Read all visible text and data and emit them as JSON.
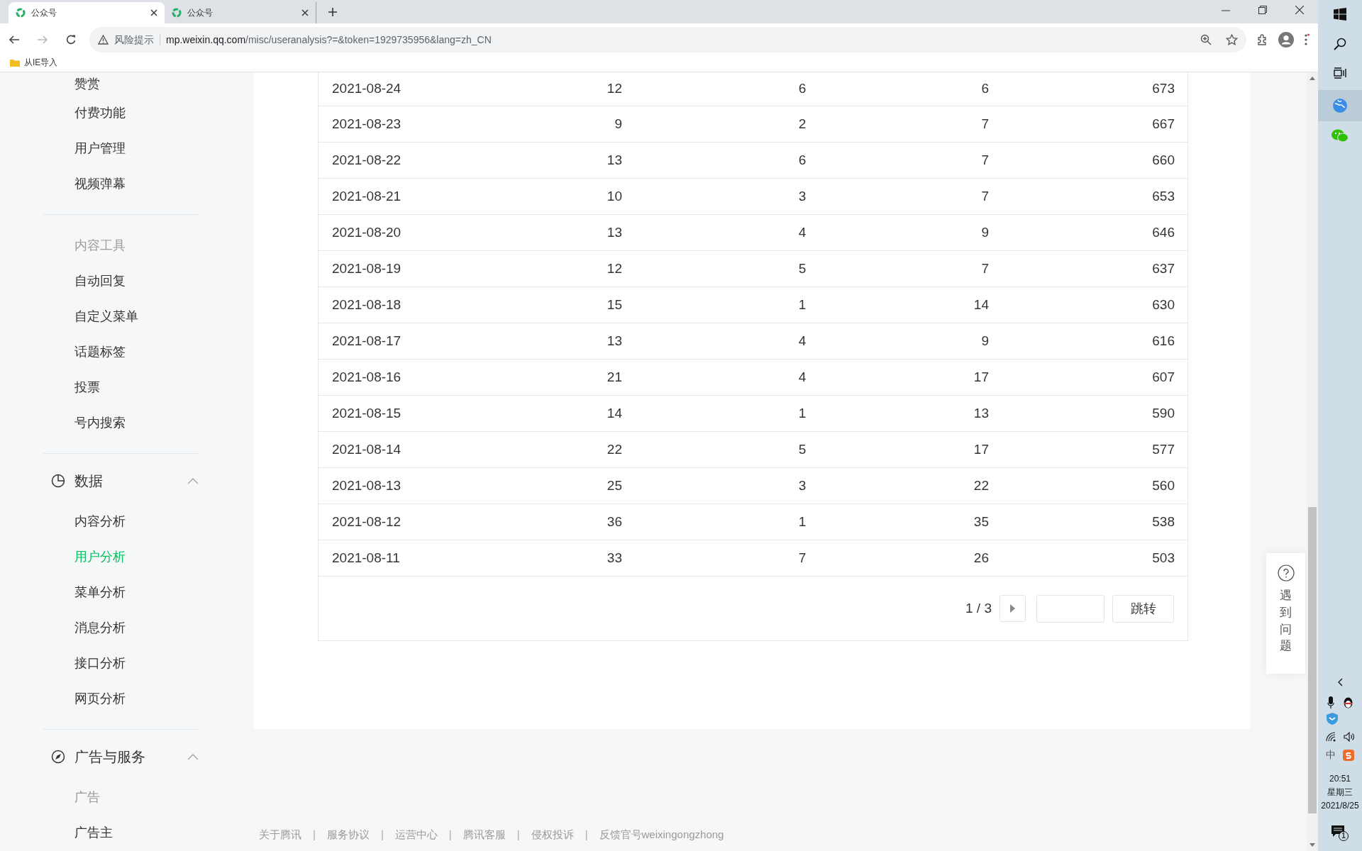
{
  "browser": {
    "tabs": [
      {
        "title": "公众号",
        "selected": true
      },
      {
        "title": "公众号",
        "selected": false
      }
    ],
    "address": {
      "warning": "风险提示",
      "host": "mp.weixin.qq.com",
      "path": "/misc/useranalysis?=&token=1929735956&lang=zh_CN"
    },
    "bookmarks": [
      {
        "label": "从IE导入"
      }
    ]
  },
  "sidebar": {
    "groups": [
      {
        "items": [
          {
            "label": "赞赏",
            "kind": "link",
            "selected": false
          },
          {
            "label": "付费功能",
            "kind": "link",
            "selected": false
          },
          {
            "label": "用户管理",
            "kind": "link",
            "selected": false
          },
          {
            "label": "视频弹幕",
            "kind": "link",
            "selected": false
          }
        ]
      },
      {
        "items": [
          {
            "label": "内容工具",
            "kind": "label",
            "selected": false
          },
          {
            "label": "自动回复",
            "kind": "link",
            "selected": false
          },
          {
            "label": "自定义菜单",
            "kind": "link",
            "selected": false
          },
          {
            "label": "话题标签",
            "kind": "link",
            "selected": false
          },
          {
            "label": "投票",
            "kind": "link",
            "selected": false
          },
          {
            "label": "号内搜索",
            "kind": "link",
            "selected": false
          }
        ]
      },
      {
        "title": "数据",
        "expanded": true,
        "items": [
          {
            "label": "内容分析",
            "kind": "link",
            "selected": false
          },
          {
            "label": "用户分析",
            "kind": "link",
            "selected": true
          },
          {
            "label": "菜单分析",
            "kind": "link",
            "selected": false
          },
          {
            "label": "消息分析",
            "kind": "link",
            "selected": false
          },
          {
            "label": "接口分析",
            "kind": "link",
            "selected": false
          },
          {
            "label": "网页分析",
            "kind": "link",
            "selected": false
          }
        ]
      },
      {
        "title": "广告与服务",
        "expanded": true,
        "items": [
          {
            "label": "广告",
            "kind": "label",
            "selected": false
          },
          {
            "label": "广告主",
            "kind": "link",
            "selected": false
          }
        ]
      }
    ]
  },
  "table": {
    "rows": [
      [
        "2021-08-24",
        "12",
        "6",
        "6",
        "673"
      ],
      [
        "2021-08-23",
        "9",
        "2",
        "7",
        "667"
      ],
      [
        "2021-08-22",
        "13",
        "6",
        "7",
        "660"
      ],
      [
        "2021-08-21",
        "10",
        "3",
        "7",
        "653"
      ],
      [
        "2021-08-20",
        "13",
        "4",
        "9",
        "646"
      ],
      [
        "2021-08-19",
        "12",
        "5",
        "7",
        "637"
      ],
      [
        "2021-08-18",
        "15",
        "1",
        "14",
        "630"
      ],
      [
        "2021-08-17",
        "13",
        "4",
        "9",
        "616"
      ],
      [
        "2021-08-16",
        "21",
        "4",
        "17",
        "607"
      ],
      [
        "2021-08-15",
        "14",
        "1",
        "13",
        "590"
      ],
      [
        "2021-08-14",
        "22",
        "5",
        "17",
        "577"
      ],
      [
        "2021-08-13",
        "25",
        "3",
        "22",
        "560"
      ],
      [
        "2021-08-12",
        "36",
        "1",
        "35",
        "538"
      ],
      [
        "2021-08-11",
        "33",
        "7",
        "26",
        "503"
      ]
    ],
    "pagination": {
      "page": "1 / 3",
      "jump_button": "跳转"
    }
  },
  "help_widget": {
    "label": "遇到问题"
  },
  "footer": [
    {
      "kind": "link",
      "text": "关于腾讯"
    },
    {
      "kind": "separator",
      "text": "|"
    },
    {
      "kind": "link",
      "text": "服务协议"
    },
    {
      "kind": "separator",
      "text": "|"
    },
    {
      "kind": "link",
      "text": "运营中心"
    },
    {
      "kind": "separator",
      "text": "|"
    },
    {
      "kind": "link",
      "text": "腾讯客服"
    },
    {
      "kind": "separator",
      "text": "|"
    },
    {
      "kind": "link",
      "text": "侵权投诉"
    },
    {
      "kind": "separator",
      "text": "|"
    },
    {
      "kind": "link",
      "text": "反馈官号weixingongzhong"
    }
  ],
  "taskbar": {
    "ime": "中",
    "time": "20:51",
    "weekday": "星期三",
    "date": "2021/8/25",
    "notifications": "1"
  }
}
